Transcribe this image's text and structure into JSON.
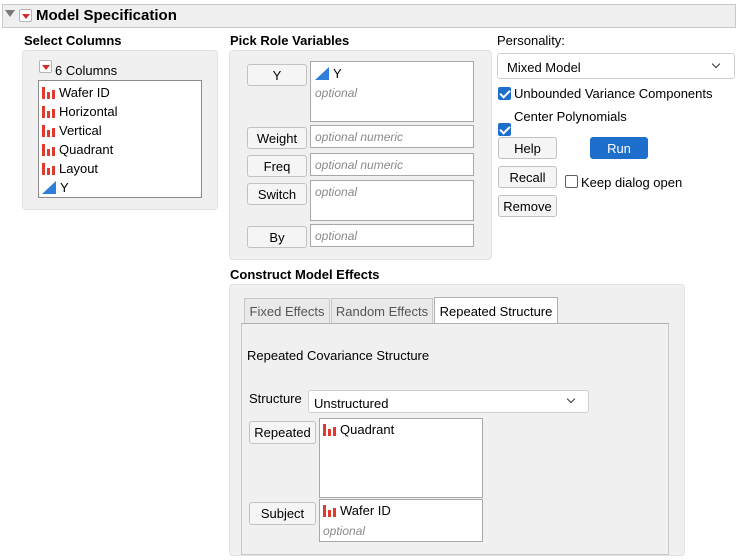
{
  "header": {
    "title": "Model Specification"
  },
  "select_columns": {
    "label": "Select Columns",
    "count_label": "6 Columns",
    "columns": [
      {
        "name": "Wafer ID",
        "type": "nominal"
      },
      {
        "name": "Horizontal",
        "type": "nominal"
      },
      {
        "name": "Vertical",
        "type": "nominal"
      },
      {
        "name": "Quadrant",
        "type": "nominal"
      },
      {
        "name": "Layout",
        "type": "nominal"
      },
      {
        "name": "Y",
        "type": "continuous"
      }
    ]
  },
  "roles": {
    "label": "Pick Role Variables",
    "y_button": "Y",
    "y_value": "Y",
    "y_placeholder": "optional",
    "weight_button": "Weight",
    "weight_placeholder": "optional numeric",
    "freq_button": "Freq",
    "freq_placeholder": "optional numeric",
    "switch_button": "Switch",
    "switch_placeholder": "optional",
    "by_button": "By",
    "by_placeholder": "optional"
  },
  "personality": {
    "label": "Personality:",
    "value": "Mixed Model",
    "unbounded_label": "Unbounded Variance Components",
    "unbounded_checked": true,
    "center_label": "Center Polynomials",
    "center_checked": true,
    "keep_open_label": "Keep dialog open",
    "keep_open_checked": false
  },
  "actions": {
    "help": "Help",
    "run": "Run",
    "recall": "Recall",
    "remove": "Remove"
  },
  "effects": {
    "label": "Construct Model Effects",
    "tabs": [
      "Fixed Effects",
      "Random Effects",
      "Repeated Structure"
    ],
    "active_tab": "Repeated Structure",
    "section_title": "Repeated Covariance Structure",
    "structure_label": "Structure",
    "structure_value": "Unstructured",
    "repeated_button": "Repeated",
    "repeated_value": "Quadrant",
    "subject_button": "Subject",
    "subject_value": "Wafer ID",
    "subject_placeholder": "optional"
  },
  "colors": {
    "accent": "#1e6fcc",
    "nominal_icon": "#e03a2e",
    "continuous_icon": "#2f7fd8",
    "menu_triangle": "#d42a2a"
  }
}
